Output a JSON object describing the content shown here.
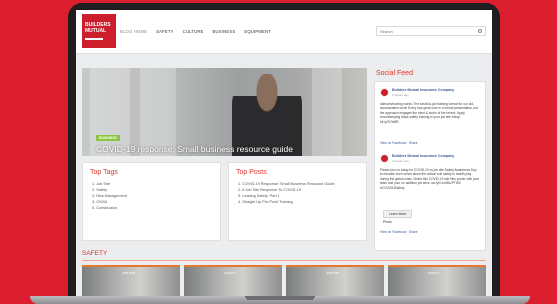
{
  "site": {
    "logo_line1": "BUILDERS",
    "logo_line2": "MUTUAL",
    "nav": [
      "BLOG HOME",
      "SAFETY",
      "CULTURE",
      "BUSINESS",
      "EQUIPMENT"
    ],
    "search_placeholder": "Search"
  },
  "hero": {
    "badge": "BUSINESS",
    "title": "COVID-19 response: Small business resource guide"
  },
  "social_feed": {
    "title": "Social Feed",
    "posts": [
      {
        "name": "Builders Mutual Insurance Company",
        "time": "2 weeks ago",
        "text": "#deconstructing words: The small-to-job training format for our old-accumulation work! Every has great over in a formal presentation, but the approach engages the mind & stutro of the recent. Apply recordkeeping stays safety training to your job site today: bit.ly/2OIn8R...",
        "actions": "View on Facebook · Share"
      },
      {
        "name": "Builders Mutual Insurance Company",
        "time": "3 weeks ago",
        "text": "Please join us today for COVID-19 vs job site Safety Awareness Day to educate even crews about the critical role safety in health play during the global crisis. Share this COVID-19 site files poster with your team and your on addition job sites: ow.ly/Cx4n50zPTWZ #COVID19Safety",
        "learn_more": "Learn More",
        "photo": "Photo",
        "actions": "View on Facebook · Share"
      }
    ]
  },
  "top_tags": {
    "title": "Top Tags",
    "items": [
      "1. Job Site",
      "2. Safety",
      "3. Risk Management",
      "4. OSHA",
      "5. Construction"
    ]
  },
  "top_posts": {
    "title": "Top Posts",
    "items": [
      "1. COVID-19 Response: Small Business Resource Guide",
      "2. A Job Site Response To COVID-19",
      "3. Leading Safety: Part 1",
      "4. Straight Up Pre-Point Training"
    ]
  },
  "safety": {
    "title": "SAFETY",
    "thumb_tags": [
      "JOB SITE",
      "SAFETY",
      "JOB SITE",
      "SAFETY"
    ]
  }
}
